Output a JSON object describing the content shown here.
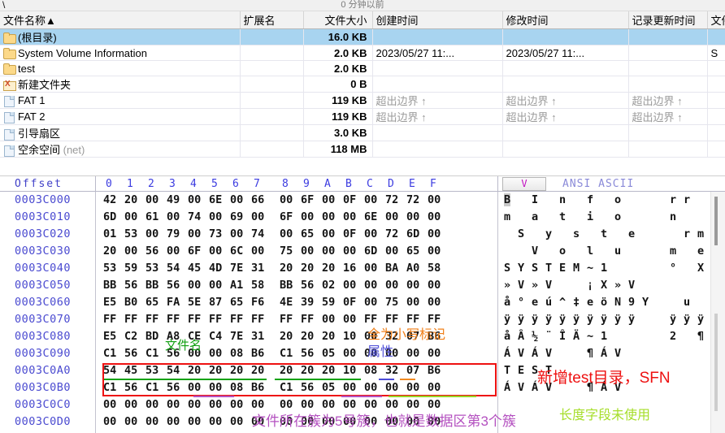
{
  "pathbar": {
    "path": "\\",
    "recent": "0 分钟以前"
  },
  "filelist": {
    "columns": [
      {
        "label": "文件名称▲",
        "align": "left"
      },
      {
        "label": "扩展名",
        "align": "left"
      },
      {
        "label": "文件大小",
        "align": "right"
      },
      {
        "label": "创建时间",
        "align": "left"
      },
      {
        "label": "修改时间",
        "align": "left"
      },
      {
        "label": "记录更新时间",
        "align": "left"
      },
      {
        "label": "文件",
        "align": "left"
      }
    ],
    "rows": [
      {
        "icon": "folder-icon",
        "name": "(根目录)",
        "ext": "",
        "size": "16.0 KB",
        "created": "",
        "modified": "",
        "record": "",
        "attr": "",
        "selected": true
      },
      {
        "icon": "folder-icon",
        "name": "System Volume Information",
        "ext": "",
        "size": "2.0 KB",
        "created": "2023/05/27  11:...",
        "modified": "2023/05/27  11:...",
        "record": "",
        "attr": "S",
        "selected": false
      },
      {
        "icon": "folder-icon",
        "name": "test",
        "ext": "",
        "size": "2.0 KB",
        "created": "",
        "modified": "",
        "record": "",
        "attr": "",
        "selected": false
      },
      {
        "icon": "folder-deleted-icon",
        "name": "新建文件夹",
        "ext": "",
        "size": "0 B",
        "created": "",
        "modified": "",
        "record": "",
        "attr": "",
        "selected": false
      },
      {
        "icon": "file-icon",
        "name": "FAT 1",
        "ext": "",
        "size": "119 KB",
        "created": "超出边界 ↑",
        "modified": "超出边界 ↑",
        "record": "超出边界 ↑",
        "attr": "",
        "selected": false
      },
      {
        "icon": "file-icon",
        "name": "FAT 2",
        "ext": "",
        "size": "119 KB",
        "created": "超出边界 ↑",
        "modified": "超出边界 ↑",
        "record": "超出边界 ↑",
        "attr": "",
        "selected": false
      },
      {
        "icon": "file-icon",
        "name": "引导扇区",
        "ext": "",
        "size": "3.0 KB",
        "created": "",
        "modified": "",
        "record": "",
        "attr": "",
        "selected": false
      },
      {
        "icon": "file-icon",
        "name": "空余空间",
        "name_suffix": "(net)",
        "ext": "",
        "size": "118 MB",
        "created": "",
        "modified": "",
        "record": "",
        "attr": "",
        "selected": false
      }
    ]
  },
  "hex": {
    "header": {
      "offset_label": "Offset",
      "columns": [
        "0",
        "1",
        "2",
        "3",
        "4",
        "5",
        "6",
        "7",
        "8",
        "9",
        "A",
        "B",
        "C",
        "D",
        "E",
        "F"
      ],
      "view_button": "V",
      "encoding_label": "ANSI ASCII"
    },
    "rows": [
      {
        "offset": "0003C000",
        "bytes": [
          "42",
          "20",
          "00",
          "49",
          "00",
          "6E",
          "00",
          "66",
          "00",
          "6F",
          "00",
          "0F",
          "00",
          "72",
          "72",
          "00"
        ],
        "ascii": "B I n f o   rr"
      },
      {
        "offset": "0003C010",
        "bytes": [
          "6D",
          "00",
          "61",
          "00",
          "74",
          "00",
          "69",
          "00",
          "6F",
          "00",
          "00",
          "00",
          "6E",
          "00",
          "00",
          "00"
        ],
        "ascii": "m a t i o   n"
      },
      {
        "offset": "0003C020",
        "bytes": [
          "01",
          "53",
          "00",
          "79",
          "00",
          "73",
          "00",
          "74",
          "00",
          "65",
          "00",
          "0F",
          "00",
          "72",
          "6D",
          "00"
        ],
        "ascii": " S y s t e   rm"
      },
      {
        "offset": "0003C030",
        "bytes": [
          "20",
          "00",
          "56",
          "00",
          "6F",
          "00",
          "6C",
          "00",
          "75",
          "00",
          "00",
          "00",
          "6D",
          "00",
          "65",
          "00"
        ],
        "ascii": "  V o l u   m e"
      },
      {
        "offset": "0003C040",
        "bytes": [
          "53",
          "59",
          "53",
          "54",
          "45",
          "4D",
          "7E",
          "31",
          "20",
          "20",
          "20",
          "16",
          "00",
          "BA",
          "A0",
          "58"
        ],
        "ascii": "SYSTEM~1    ° X"
      },
      {
        "offset": "0003C050",
        "bytes": [
          "BB",
          "56",
          "BB",
          "56",
          "00",
          "00",
          "A1",
          "58",
          "BB",
          "56",
          "02",
          "00",
          "00",
          "00",
          "00",
          "00"
        ],
        "ascii": "»V»V  ¡X»V"
      },
      {
        "offset": "0003C060",
        "bytes": [
          "E5",
          "B0",
          "65",
          "FA",
          "5E",
          "87",
          "65",
          "F6",
          "4E",
          "39",
          "59",
          "0F",
          "00",
          "75",
          "00",
          "00"
        ],
        "ascii": "å°eú^‡eöN9Y  u"
      },
      {
        "offset": "0003C070",
        "bytes": [
          "FF",
          "FF",
          "FF",
          "FF",
          "FF",
          "FF",
          "FF",
          "FF",
          "FF",
          "FF",
          "00",
          "00",
          "FF",
          "FF",
          "FF",
          "FF"
        ],
        "ascii": "ÿÿÿÿÿÿÿÿÿÿ  ÿÿÿÿ"
      },
      {
        "offset": "0003C080",
        "bytes": [
          "E5",
          "C2",
          "BD",
          "A8",
          "CE",
          "C4",
          "7E",
          "31",
          "20",
          "20",
          "20",
          "10",
          "00",
          "32",
          "07",
          "B6"
        ],
        "ascii": "åÂ½¨ÎÄ~1    2 ¶"
      },
      {
        "offset": "0003C090",
        "bytes": [
          "C1",
          "56",
          "C1",
          "56",
          "00",
          "00",
          "08",
          "B6",
          "C1",
          "56",
          "05",
          "00",
          "00",
          "00",
          "00",
          "00"
        ],
        "ascii": "ÁVÁV  ¶ÁV"
      },
      {
        "offset": "0003C0A0",
        "bytes": [
          "54",
          "45",
          "53",
          "54",
          "20",
          "20",
          "20",
          "20",
          "20",
          "20",
          "20",
          "10",
          "08",
          "32",
          "07",
          "B6"
        ],
        "ascii": "TEST"
      },
      {
        "offset": "0003C0B0",
        "bytes": [
          "C1",
          "56",
          "C1",
          "56",
          "00",
          "00",
          "08",
          "B6",
          "C1",
          "56",
          "05",
          "00",
          "00",
          "00",
          "00",
          "00"
        ],
        "ascii": "ÁVÁV  ¶ÁV"
      },
      {
        "offset": "0003C0C0",
        "bytes": [
          "00",
          "00",
          "00",
          "00",
          "00",
          "00",
          "00",
          "00",
          "00",
          "00",
          "00",
          "00",
          "00",
          "00",
          "00",
          "00"
        ],
        "ascii": ""
      },
      {
        "offset": "0003C0D0",
        "bytes": [
          "00",
          "00",
          "00",
          "00",
          "00",
          "00",
          "00",
          "00",
          "00",
          "00",
          "00",
          "00",
          "00",
          "00",
          "00",
          "00"
        ],
        "ascii": ""
      }
    ]
  },
  "annotations": {
    "filename_label": "文件名",
    "lowercase_flag_label": "全为小写标记",
    "attribute_label": "属性",
    "new_test_dir_label": "新增test目录，SFN",
    "cluster_label": "文件所在簇为5号簇，也就是数据区第3个簇",
    "length_unused_label": "长度字段未使用"
  },
  "colors": {
    "red": "#ee1111",
    "green": "#12a012",
    "orange": "#f0801a",
    "blue": "#5050d8",
    "purple": "#b451c0",
    "lime": "#a6de2a",
    "selection": "#a8d4f0",
    "hex_offset": "#4a4ad0",
    "highlight_bg": "#0a24d6",
    "highlight_fg": "#ffe400"
  }
}
